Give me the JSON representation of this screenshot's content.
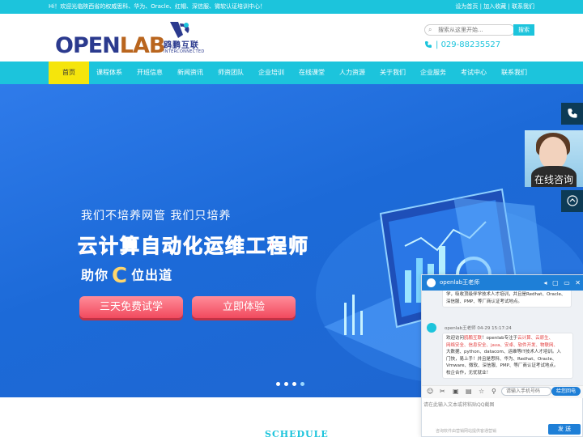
{
  "topbar": {
    "welcome": "Hi！欢迎光临陕西省的权威思科、华为、Oracle、红帽、深信服、微软认证培训中心！",
    "links": "设为首页 | 加入收藏 | 联系我们"
  },
  "logo": {
    "open": "OPEN",
    "lab": "LAB",
    "cn": "鸥鹏互联",
    "en": "INTERCONNECTED"
  },
  "search": {
    "placeholder": "搜索从这里开始...",
    "button": "搜索"
  },
  "phone": "029-88235527",
  "nav": [
    {
      "label": "首页",
      "active": true
    },
    {
      "label": "课程体系"
    },
    {
      "label": "开班信息"
    },
    {
      "label": "新闻资讯"
    },
    {
      "label": "师资团队"
    },
    {
      "label": "企业培训"
    },
    {
      "label": "在线课堂"
    },
    {
      "label": "人力资源"
    },
    {
      "label": "关于我们"
    },
    {
      "label": "企业服务"
    },
    {
      "label": "考试中心"
    },
    {
      "label": "联系我们"
    }
  ],
  "banner": {
    "tagline": "我们不培养网管 我们只培养",
    "title": "云计算自动化运维工程师",
    "sub_pre": "助你",
    "sub_c": "C",
    "sub_post": "位出道",
    "btn_trial": "三天免费试学",
    "btn_experience": "立即体验"
  },
  "carousel": {
    "count": 4,
    "current": 4
  },
  "schedule": "SCHEDULE",
  "sidebar": {
    "consult_label": "在线咨询",
    "icons": [
      "phone-icon",
      "headset-icon",
      "back-to-top-icon"
    ]
  },
  "chat": {
    "title": "openlab王老师",
    "msg1_tail_l1": "学，吸收顶级伴学技术人才培训，并且是Redhat、Oracle、",
    "msg1_tail_l2": "深信服、PMP、等厂商认证考试地点。",
    "msg2_meta": "openlab王老师 04-29 15:17:24",
    "msg2_l1_a": "欢迎访问",
    "msg2_l1_b": "鸥鹏互联",
    "msg2_l1_c": "！openlab专注于",
    "msg2_l1_d": "云计算、云原生、",
    "msg2_l2": "网络安全、信息安全、java、安卓、软件开发、物联网、",
    "msg2_l3": "大数据、python、datacom、运维等IT技术人才培训。入",
    "msg2_l4": "门快，易上手！并且是思科、华为、Redhat、Oracle、",
    "msg2_l5": "Vmware、微软、深信服、PMP、等厂商认证考试地点。",
    "msg2_l6": "校企合作，无忧就业！",
    "phone_placeholder": "请输入手机号码",
    "callback_button": "给您回电",
    "input_placeholder": "请在此输入文本或将粘贴QQ截图",
    "footer": "咨询软件由营销网站提供客通营销",
    "send_button": "发 送",
    "brand_color": "#1e7fd7"
  },
  "colors": {
    "accent": "#1cc4dc",
    "active_nav": "#f5e50c",
    "banner": "#2f7bea",
    "side_dark": "#0d3b56"
  }
}
